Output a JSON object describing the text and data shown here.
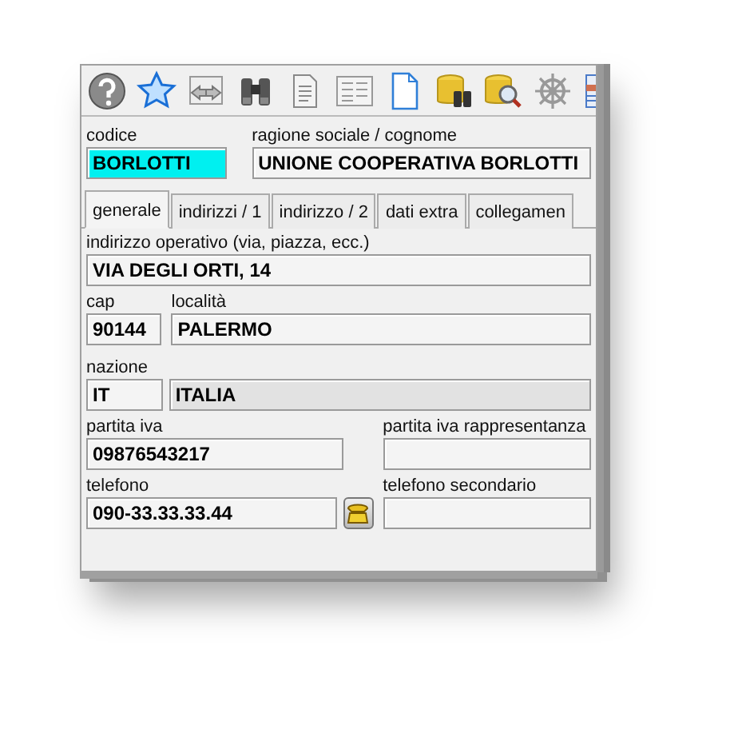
{
  "header_fields": [
    {
      "label": "codice",
      "value": "BORLOTTI",
      "highlighted": true
    },
    {
      "label": "ragione sociale / cognome",
      "value": "UNIONE COOPERATIVA BORLOTTI",
      "highlighted": false
    }
  ],
  "tabs": [
    {
      "label": "generale",
      "selected": true
    },
    {
      "label": "indirizzi / 1",
      "selected": false
    },
    {
      "label": "indirizzo / 2",
      "selected": false
    },
    {
      "label": "dati extra",
      "selected": false
    },
    {
      "label": "collegamen",
      "selected": false
    }
  ],
  "address": {
    "label": "indirizzo operativo (via, piazza, ecc.)",
    "value": "VIA DEGLI ORTI, 14"
  },
  "cap": {
    "label": "cap",
    "value": "90144"
  },
  "localita": {
    "label": "località",
    "value": "PALERMO"
  },
  "nazione": {
    "label": "nazione",
    "code": "IT",
    "name": "ITALIA",
    "name_readonly": true
  },
  "partita_iva": {
    "label": "partita iva",
    "value": "09876543217"
  },
  "partita_iva_rappresentanza": {
    "label": "partita iva rappresentanza"
  },
  "telefono": {
    "label": "telefono",
    "value": "090-33.33.33.44"
  },
  "telefono_secondario": {
    "label": "telefono secondario"
  }
}
